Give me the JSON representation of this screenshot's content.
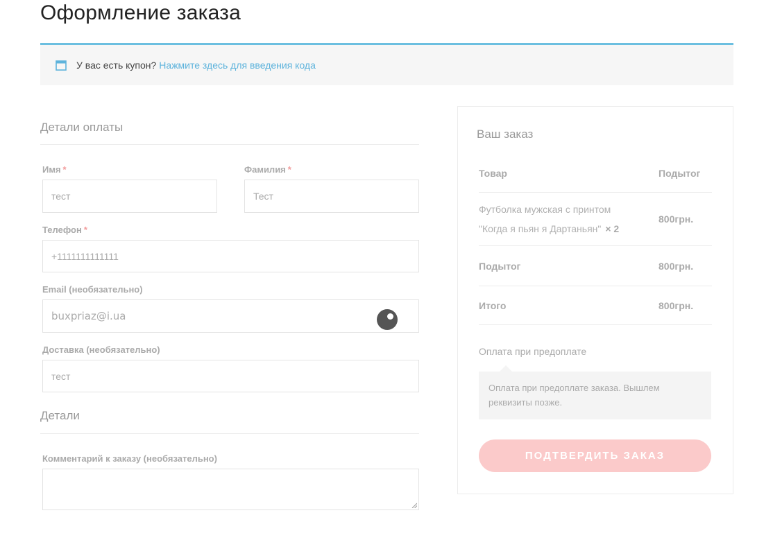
{
  "page": {
    "title": "Оформление заказа"
  },
  "coupon": {
    "text": "У вас есть купон?",
    "link": "Нажмите здесь для введения кода"
  },
  "billing": {
    "title": "Детали оплаты",
    "first_name": {
      "label": "Имя",
      "required": "*",
      "value": "тест"
    },
    "last_name": {
      "label": "Фамилия",
      "required": "*",
      "value": "Тест"
    },
    "phone": {
      "label": "Телефон",
      "required": "*",
      "value": "+1111111111111"
    },
    "email": {
      "label": "Email (необязательно)",
      "value": "buxpriaz@i.ua"
    },
    "delivery": {
      "label": "Доставка (необязательно)",
      "value": "тест"
    }
  },
  "details": {
    "title": "Детали",
    "comment": {
      "label": "Комментарий к заказу (необязательно)",
      "value": ""
    }
  },
  "order": {
    "title": "Ваш заказ",
    "col_product": "Товар",
    "col_subtotal": "Подытог",
    "item": {
      "name_line1": "Футболка мужская с принтом",
      "name_line2": "\"Когда я пьян я Дартаньян\"",
      "qty": "× 2",
      "price": "800грн."
    },
    "subtotal": {
      "label": "Подытог",
      "value": "800грн."
    },
    "total": {
      "label": "Итого",
      "value": "800грн."
    },
    "payment_method": "Оплата при предоплате",
    "payment_desc": "Оплата при предоплате заказа. Вышлем реквизиты позже.",
    "confirm": "ПОДТВЕРДИТЬ ЗАКАЗ"
  },
  "colors": {
    "accent": "#6cbfe0",
    "link": "#5db3dc",
    "required": "#f29c9c",
    "button": "#fbcaca"
  }
}
